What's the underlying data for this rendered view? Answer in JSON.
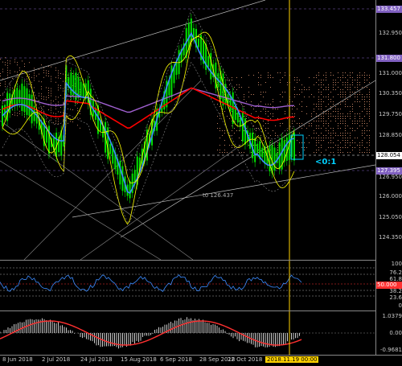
{
  "colors": {
    "background": "#000000",
    "bull_candle": "#00e000",
    "yellow_lines": "#ffff00",
    "red_ma": "#ff0000",
    "blue_ma": "#3c8cff",
    "purple_line": "#a060d0",
    "cloud": "#c08060",
    "cyan": "#00d0ff",
    "highlight_violet": "#8060c0",
    "current_price_bg": "#ffffff",
    "stoch_red": "#ff3030",
    "date_marker": "#ffd200"
  },
  "main_axis": {
    "labels": [
      "132.950",
      "131.800",
      "131.000",
      "130.350",
      "129.750",
      "128.850",
      "128.054",
      "127.395",
      "126.950",
      "126.000",
      "125.050",
      "124.350"
    ],
    "highlight_top": "133.457",
    "highlight_mid": "131.800",
    "highlight_low": "127.395",
    "current_price": "128.054"
  },
  "annotations": {
    "low_label": "t0 126.437",
    "ratio_label": "<0:1"
  },
  "rsi_axis": {
    "labels": [
      "100",
      "76.2",
      "61.8",
      "38.2",
      "23.6",
      "0"
    ],
    "current": "50.000"
  },
  "macd_axis": {
    "labels": [
      "1.0379",
      "0.00",
      "-0.9681"
    ]
  },
  "time_axis": {
    "labels": [
      "8 Jun 2018",
      "2 Jul 2018",
      "24 Jul 2018",
      "15 Aug 2018",
      "6 Sep 2018",
      "28 Sep 2018",
      "22 Oct 2018"
    ],
    "cursor_label": "2018.11.19 00:00"
  }
}
